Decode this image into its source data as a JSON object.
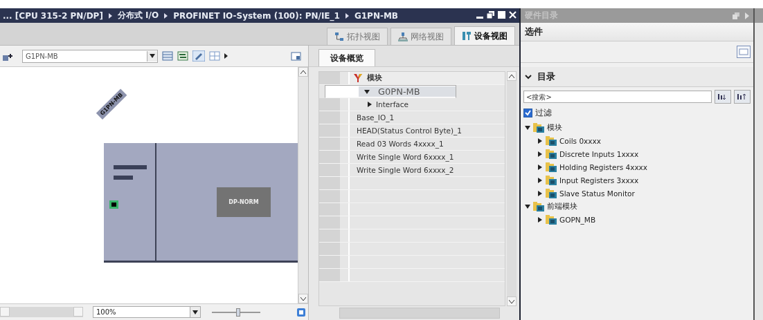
{
  "breadcrumb": [
    "... [CPU 315-2 PN/DP]",
    "分布式 I/O",
    "PROFINET IO-System (100): PN/IE_1",
    "G1PN-MB"
  ],
  "view_tabs": [
    {
      "label": "拓扑视图",
      "kind": "topology",
      "selected": false
    },
    {
      "label": "网络视图",
      "kind": "network",
      "selected": false
    },
    {
      "label": "设备视图",
      "kind": "device",
      "selected": true
    }
  ],
  "canvas": {
    "device_selector": "G1PN-MB",
    "device_label": "G1PN-MB",
    "module_label": "DP-NORM",
    "zoom": "100%",
    "zoom_slider": {
      "level": 0.55
    }
  },
  "overview": {
    "tab": "设备概览",
    "column": "模块",
    "rows": [
      {
        "name": "G0PN-MB",
        "kind": "device",
        "expanded": true,
        "selected": true
      },
      {
        "name": "Interface",
        "kind": "folder",
        "expanded": false,
        "selected": false
      },
      {
        "name": "Base_IO_1",
        "kind": "module",
        "selected": false
      },
      {
        "name": "HEAD(Status Control Byte)_1",
        "kind": "module",
        "selected": false
      },
      {
        "name": "Read 03 Words 4xxxx_1",
        "kind": "module",
        "selected": false
      },
      {
        "name": "Write Single Word 6xxxx_1",
        "kind": "module",
        "selected": false
      },
      {
        "name": "Write Single Word 6xxxx_2",
        "kind": "module",
        "selected": false
      }
    ]
  },
  "catalog": {
    "title": "硬件目录",
    "options": "选件",
    "section": "目录",
    "section_expanded": true,
    "search": {
      "placeholder": "<搜索>"
    },
    "filter": {
      "label": "过滤",
      "checked": true
    },
    "tree": [
      {
        "label": "模块",
        "expanded": true,
        "children": [
          {
            "label": "Coils 0xxxx",
            "expanded": false
          },
          {
            "label": "Discrete Inputs 1xxxx",
            "expanded": false
          },
          {
            "label": "Holding Registers 4xxxx",
            "expanded": false
          },
          {
            "label": "Input Registers 3xxxx",
            "expanded": false
          },
          {
            "label": "Slave Status Monitor",
            "expanded": false
          }
        ]
      },
      {
        "label": "前端模块",
        "expanded": true,
        "children": [
          {
            "label": "GOPN_MB",
            "expanded": false
          }
        ]
      }
    ]
  }
}
